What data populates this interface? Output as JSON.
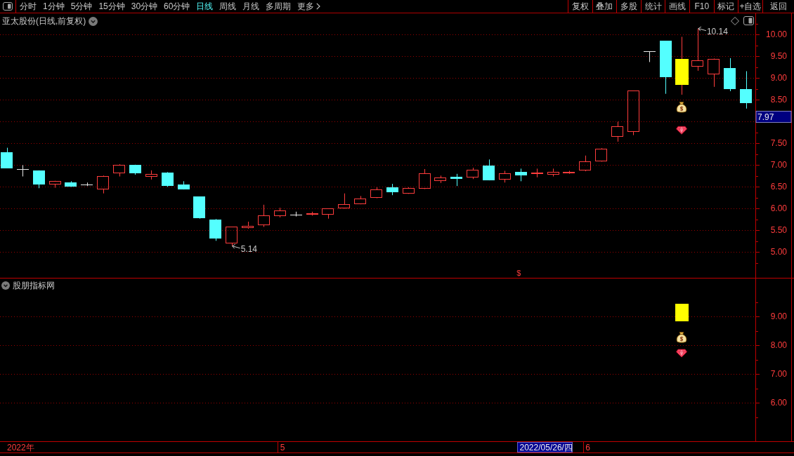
{
  "toolbar": {
    "periods": [
      {
        "label": "分时",
        "selected": false
      },
      {
        "label": "1分钟",
        "selected": false
      },
      {
        "label": "5分钟",
        "selected": false
      },
      {
        "label": "15分钟",
        "selected": false
      },
      {
        "label": "30分钟",
        "selected": false
      },
      {
        "label": "60分钟",
        "selected": false
      },
      {
        "label": "日线",
        "selected": true
      },
      {
        "label": "周线",
        "selected": false
      },
      {
        "label": "月线",
        "selected": false
      },
      {
        "label": "多周期",
        "selected": false
      }
    ],
    "more": "更多",
    "actions": [
      "复权",
      "叠加",
      "多股",
      "统计",
      "画线",
      "F10",
      "标记",
      "+自选",
      "返回"
    ]
  },
  "main_panel": {
    "title": "亚太股份(日线,前复权)",
    "high_label": "10.14",
    "low_label": "5.14",
    "marker": "$",
    "price_axis": [
      "10.00",
      "9.50",
      "9.00",
      "8.50",
      "7.50",
      "7.00",
      "6.50",
      "6.00",
      "5.50",
      "5.00"
    ],
    "current_price": "7.97"
  },
  "indicator_panel": {
    "title": "股朋指标网",
    "value_axis": [
      "9.00",
      "8.00",
      "7.00",
      "6.00"
    ]
  },
  "time_axis": {
    "labels": [
      "2022年",
      "5",
      "6"
    ],
    "cursor_date": "2022/05/26/四"
  }
}
